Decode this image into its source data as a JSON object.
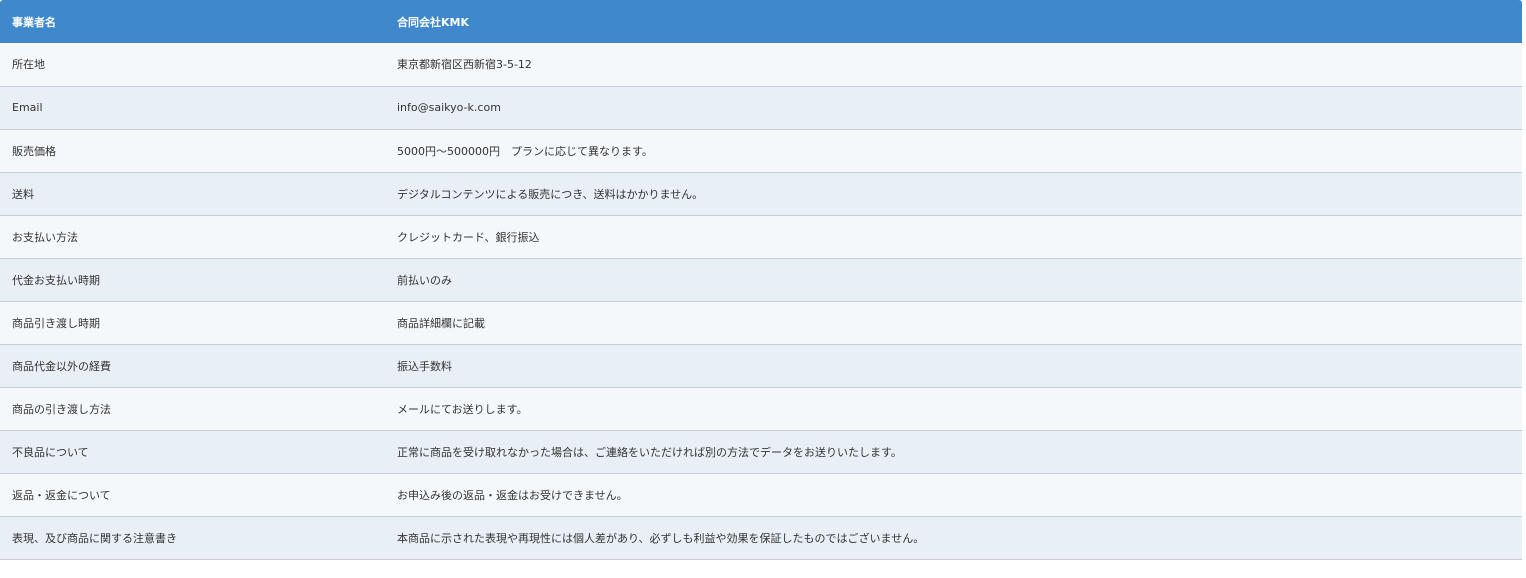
{
  "header": {
    "label": "事業者名",
    "value": "合同会社KMK"
  },
  "rows": [
    {
      "label": "所在地",
      "value": "東京都新宿区西新宿3-5-12"
    },
    {
      "label": "Email",
      "value": "info@saikyo-k.com"
    },
    {
      "label": "販売価格",
      "value": "5000円〜500000円　プランに応じて異なります。"
    },
    {
      "label": "送料",
      "value": "デジタルコンテンツによる販売につき、送料はかかりません。"
    },
    {
      "label": "お支払い方法",
      "value": "クレジットカード、銀行振込"
    },
    {
      "label": "代金お支払い時期",
      "value": "前払いのみ"
    },
    {
      "label": "商品引き渡し時期",
      "value": "商品詳細欄に記載"
    },
    {
      "label": "商品代金以外の経費",
      "value": "振込手数料"
    },
    {
      "label": "商品の引き渡し方法",
      "value": "メールにてお送りします。"
    },
    {
      "label": "不良品について",
      "value": "正常に商品を受け取れなかった場合は、ご連絡をいただければ別の方法でデータをお送りいたします。"
    },
    {
      "label": "返品・返金について",
      "value": "お申込み後の返品・返金はお受けできません。"
    },
    {
      "label": "表現、及び商品に関する注意書き",
      "value": "本商品に示された表現や再現性には個人差があり、必ずしも利益や効果を保証したものではございません。"
    }
  ]
}
